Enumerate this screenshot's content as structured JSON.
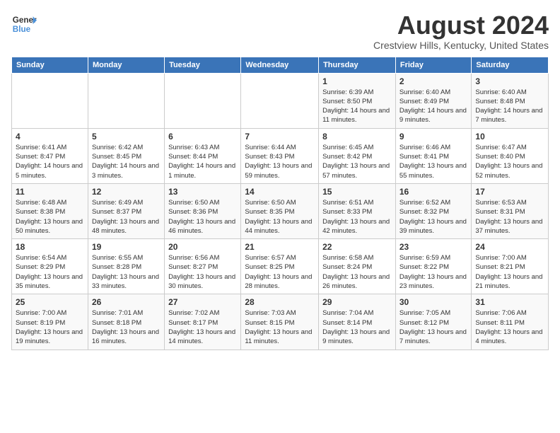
{
  "logo": {
    "line1": "General",
    "line2": "Blue"
  },
  "title": "August 2024",
  "location": "Crestview Hills, Kentucky, United States",
  "days_of_week": [
    "Sunday",
    "Monday",
    "Tuesday",
    "Wednesday",
    "Thursday",
    "Friday",
    "Saturday"
  ],
  "weeks": [
    [
      {
        "num": "",
        "info": ""
      },
      {
        "num": "",
        "info": ""
      },
      {
        "num": "",
        "info": ""
      },
      {
        "num": "",
        "info": ""
      },
      {
        "num": "1",
        "info": "Sunrise: 6:39 AM\nSunset: 8:50 PM\nDaylight: 14 hours and 11 minutes."
      },
      {
        "num": "2",
        "info": "Sunrise: 6:40 AM\nSunset: 8:49 PM\nDaylight: 14 hours and 9 minutes."
      },
      {
        "num": "3",
        "info": "Sunrise: 6:40 AM\nSunset: 8:48 PM\nDaylight: 14 hours and 7 minutes."
      }
    ],
    [
      {
        "num": "4",
        "info": "Sunrise: 6:41 AM\nSunset: 8:47 PM\nDaylight: 14 hours and 5 minutes."
      },
      {
        "num": "5",
        "info": "Sunrise: 6:42 AM\nSunset: 8:45 PM\nDaylight: 14 hours and 3 minutes."
      },
      {
        "num": "6",
        "info": "Sunrise: 6:43 AM\nSunset: 8:44 PM\nDaylight: 14 hours and 1 minute."
      },
      {
        "num": "7",
        "info": "Sunrise: 6:44 AM\nSunset: 8:43 PM\nDaylight: 13 hours and 59 minutes."
      },
      {
        "num": "8",
        "info": "Sunrise: 6:45 AM\nSunset: 8:42 PM\nDaylight: 13 hours and 57 minutes."
      },
      {
        "num": "9",
        "info": "Sunrise: 6:46 AM\nSunset: 8:41 PM\nDaylight: 13 hours and 55 minutes."
      },
      {
        "num": "10",
        "info": "Sunrise: 6:47 AM\nSunset: 8:40 PM\nDaylight: 13 hours and 52 minutes."
      }
    ],
    [
      {
        "num": "11",
        "info": "Sunrise: 6:48 AM\nSunset: 8:38 PM\nDaylight: 13 hours and 50 minutes."
      },
      {
        "num": "12",
        "info": "Sunrise: 6:49 AM\nSunset: 8:37 PM\nDaylight: 13 hours and 48 minutes."
      },
      {
        "num": "13",
        "info": "Sunrise: 6:50 AM\nSunset: 8:36 PM\nDaylight: 13 hours and 46 minutes."
      },
      {
        "num": "14",
        "info": "Sunrise: 6:50 AM\nSunset: 8:35 PM\nDaylight: 13 hours and 44 minutes."
      },
      {
        "num": "15",
        "info": "Sunrise: 6:51 AM\nSunset: 8:33 PM\nDaylight: 13 hours and 42 minutes."
      },
      {
        "num": "16",
        "info": "Sunrise: 6:52 AM\nSunset: 8:32 PM\nDaylight: 13 hours and 39 minutes."
      },
      {
        "num": "17",
        "info": "Sunrise: 6:53 AM\nSunset: 8:31 PM\nDaylight: 13 hours and 37 minutes."
      }
    ],
    [
      {
        "num": "18",
        "info": "Sunrise: 6:54 AM\nSunset: 8:29 PM\nDaylight: 13 hours and 35 minutes."
      },
      {
        "num": "19",
        "info": "Sunrise: 6:55 AM\nSunset: 8:28 PM\nDaylight: 13 hours and 33 minutes."
      },
      {
        "num": "20",
        "info": "Sunrise: 6:56 AM\nSunset: 8:27 PM\nDaylight: 13 hours and 30 minutes."
      },
      {
        "num": "21",
        "info": "Sunrise: 6:57 AM\nSunset: 8:25 PM\nDaylight: 13 hours and 28 minutes."
      },
      {
        "num": "22",
        "info": "Sunrise: 6:58 AM\nSunset: 8:24 PM\nDaylight: 13 hours and 26 minutes."
      },
      {
        "num": "23",
        "info": "Sunrise: 6:59 AM\nSunset: 8:22 PM\nDaylight: 13 hours and 23 minutes."
      },
      {
        "num": "24",
        "info": "Sunrise: 7:00 AM\nSunset: 8:21 PM\nDaylight: 13 hours and 21 minutes."
      }
    ],
    [
      {
        "num": "25",
        "info": "Sunrise: 7:00 AM\nSunset: 8:19 PM\nDaylight: 13 hours and 19 minutes."
      },
      {
        "num": "26",
        "info": "Sunrise: 7:01 AM\nSunset: 8:18 PM\nDaylight: 13 hours and 16 minutes."
      },
      {
        "num": "27",
        "info": "Sunrise: 7:02 AM\nSunset: 8:17 PM\nDaylight: 13 hours and 14 minutes."
      },
      {
        "num": "28",
        "info": "Sunrise: 7:03 AM\nSunset: 8:15 PM\nDaylight: 13 hours and 11 minutes."
      },
      {
        "num": "29",
        "info": "Sunrise: 7:04 AM\nSunset: 8:14 PM\nDaylight: 13 hours and 9 minutes."
      },
      {
        "num": "30",
        "info": "Sunrise: 7:05 AM\nSunset: 8:12 PM\nDaylight: 13 hours and 7 minutes."
      },
      {
        "num": "31",
        "info": "Sunrise: 7:06 AM\nSunset: 8:11 PM\nDaylight: 13 hours and 4 minutes."
      }
    ]
  ]
}
